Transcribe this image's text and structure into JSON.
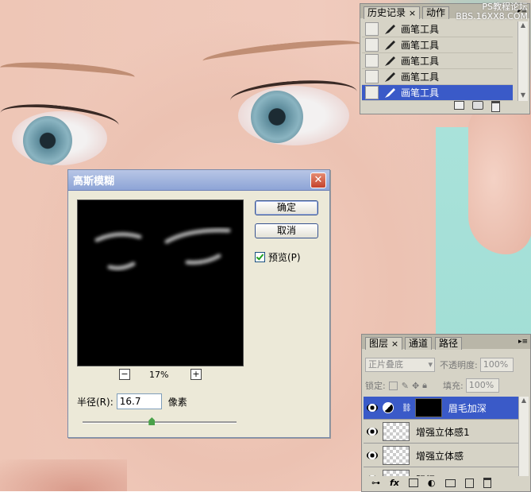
{
  "watermark": {
    "line1": "PS教程论坛",
    "line2": "BBS.16XX8.COM"
  },
  "history_panel": {
    "tabs": [
      {
        "label": "历史记录",
        "close": "×"
      },
      {
        "label": "动作"
      }
    ],
    "items": [
      {
        "label": "画笔工具"
      },
      {
        "label": "画笔工具"
      },
      {
        "label": "画笔工具"
      },
      {
        "label": "画笔工具"
      },
      {
        "label": "画笔工具",
        "selected": true
      }
    ]
  },
  "gaussian_dialog": {
    "title": "高斯模糊",
    "close": "✕",
    "ok_label": "确定",
    "cancel_label": "取消",
    "preview_label": "预览(P)",
    "preview_checked": true,
    "zoom_minus": "−",
    "zoom_plus": "+",
    "zoom_value": "17%",
    "radius_label": "半径(R):",
    "radius_value": "16.7",
    "radius_unit": "像素",
    "slider_level_fraction": 0.45
  },
  "layers_panel": {
    "tabs": [
      {
        "label": "图层",
        "close": "×"
      },
      {
        "label": "通道"
      },
      {
        "label": "路径"
      }
    ],
    "blend_mode": "正片叠底",
    "opacity_label": "不透明度:",
    "opacity_value": "100%",
    "lock_label": "锁定:",
    "fill_label": "填充:",
    "fill_value": "100%",
    "layers": [
      {
        "name": "眉毛加深",
        "selected": true,
        "thumb": "black"
      },
      {
        "name": "增强立体感1",
        "thumb": "transparent"
      },
      {
        "name": "增强立体感",
        "thumb": "transparent"
      },
      {
        "name": "阴行",
        "thumb": "transparent"
      }
    ],
    "footer_fx": "fx"
  },
  "colors": {
    "selection": "#3a5ac8",
    "panel_bg": "#d6d3c6",
    "dialog_bg": "#ece9d8"
  }
}
